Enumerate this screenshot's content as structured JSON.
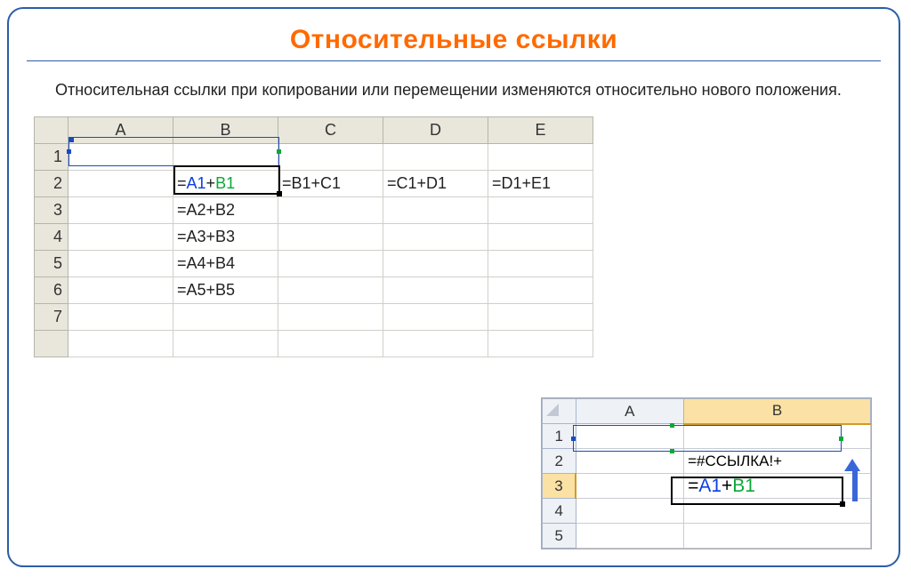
{
  "title": "Относительные ссылки",
  "description": "Относительная ссылки при копировании или перемещении изменяются относительно нового положения.",
  "main_sheet": {
    "columns": [
      "A",
      "B",
      "C",
      "D",
      "E"
    ],
    "rows": [
      "1",
      "2",
      "3",
      "4",
      "5",
      "6",
      "7"
    ],
    "selected_col": "B",
    "selected_row": "2",
    "active_formula": {
      "eq": "=",
      "ref1": "A1",
      "plus": "+",
      "ref2": "B1"
    },
    "cells": {
      "C2": "=B1+C1",
      "D2": "=C1+D1",
      "E2": "=D1+E1",
      "B3": "=A2+B2",
      "B4": "=A3+B3",
      "B5": "=A4+B4",
      "B6": "=A5+B5"
    }
  },
  "inset_sheet": {
    "columns": [
      "A",
      "B"
    ],
    "rows": [
      "1",
      "2",
      "3",
      "4",
      "5"
    ],
    "selected_col": "B",
    "selected_row": "3",
    "b2_text": "=#ССЫЛКА!+",
    "b3_formula": {
      "eq": "=",
      "ref1": "A1",
      "plus": "+",
      "ref2": "B1"
    }
  }
}
